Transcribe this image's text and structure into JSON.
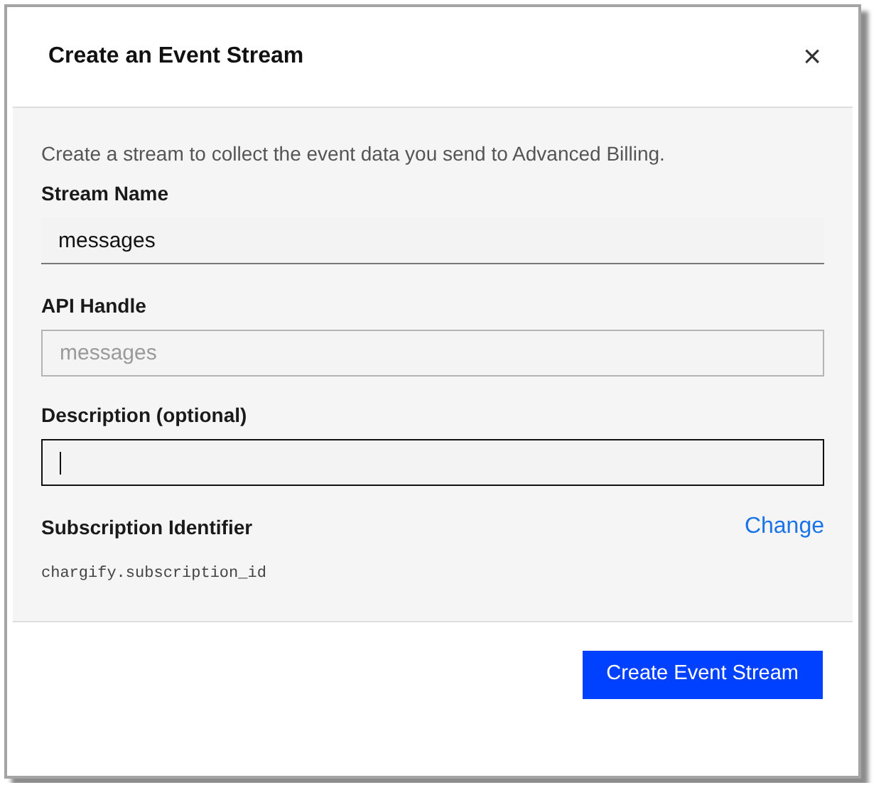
{
  "dialog": {
    "title": "Create an Event Stream",
    "close": "×"
  },
  "intro": "Create a stream to collect the event data you send to Advanced Billing.",
  "fields": [
    {
      "label": "Stream Name",
      "kind": "underline",
      "value": "messages",
      "disabled": false,
      "focused": false
    },
    {
      "label": "API Handle",
      "kind": "outline",
      "placeholder": "messages",
      "disabled": true,
      "focused": false
    },
    {
      "label": "Description (optional)",
      "kind": "outline",
      "disabled": false,
      "focused": true
    }
  ],
  "identifier": {
    "label": "Subscription Identifier",
    "action": "Change",
    "value": "chargify.subscription_id"
  },
  "buttons": [
    {
      "label": "Create Event Stream",
      "kind": "primary"
    }
  ]
}
